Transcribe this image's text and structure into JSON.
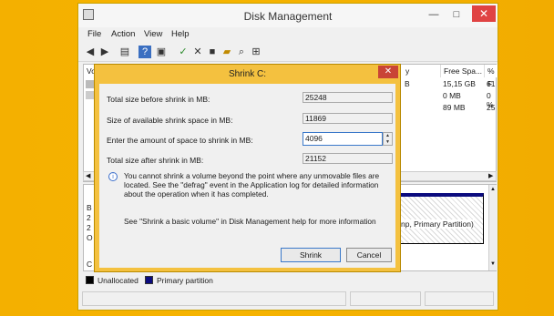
{
  "window": {
    "title": "Disk Management",
    "min": "—",
    "max": "□",
    "close": "✕"
  },
  "menu": [
    "File",
    "Action",
    "View",
    "Help"
  ],
  "list": {
    "headers": {
      "volume": "Vo",
      "capacity": "y",
      "free_space": "Free Spa...",
      "pct_free": "% F"
    },
    "rows": [
      {
        "cap": "B",
        "free": "15,15 GB",
        "pct": "61"
      },
      {
        "cap": "",
        "free": "0 MB",
        "pct": "0 %"
      },
      {
        "cap": "",
        "free": "89 MB",
        "pct": "25"
      }
    ]
  },
  "graph": {
    "disk_label_partial": [
      "B",
      "2",
      "2",
      "O"
    ],
    "partition_label": "np, Primary Partition)",
    "cd_label_partial": "C"
  },
  "legend": {
    "unallocated": "Unallocated",
    "primary": "Primary partition"
  },
  "dialog": {
    "title": "Shrink C:",
    "close": "✕",
    "total_before_label": "Total size before shrink in MB:",
    "total_before_value": "25248",
    "available_label": "Size of available shrink space in MB:",
    "available_value": "11869",
    "amount_label": "Enter the amount of space to shrink in MB:",
    "amount_value": "4096",
    "total_after_label": "Total size after shrink in MB:",
    "total_after_value": "21152",
    "info_text": "You cannot shrink a volume beyond the point where any unmovable files are located. See the \"defrag\" event in the Application log for detailed information about the operation when it has completed.",
    "help_text": "See \"Shrink a basic volume\" in Disk Management help for more information",
    "shrink_button": "Shrink",
    "cancel_button": "Cancel"
  },
  "colors": {
    "desktop": "#f4b000",
    "dialog_frame": "#f4c13f",
    "close_red": "#e04343",
    "primary_partition": "#0b0b7e"
  },
  "icons": [
    "back-arrow-icon",
    "forward-arrow-icon",
    "properties-icon",
    "help-icon",
    "disk-list-icon",
    "check-icon",
    "delete-icon",
    "new-icon",
    "open-icon",
    "search-icon",
    "export-icon",
    "info-icon"
  ]
}
